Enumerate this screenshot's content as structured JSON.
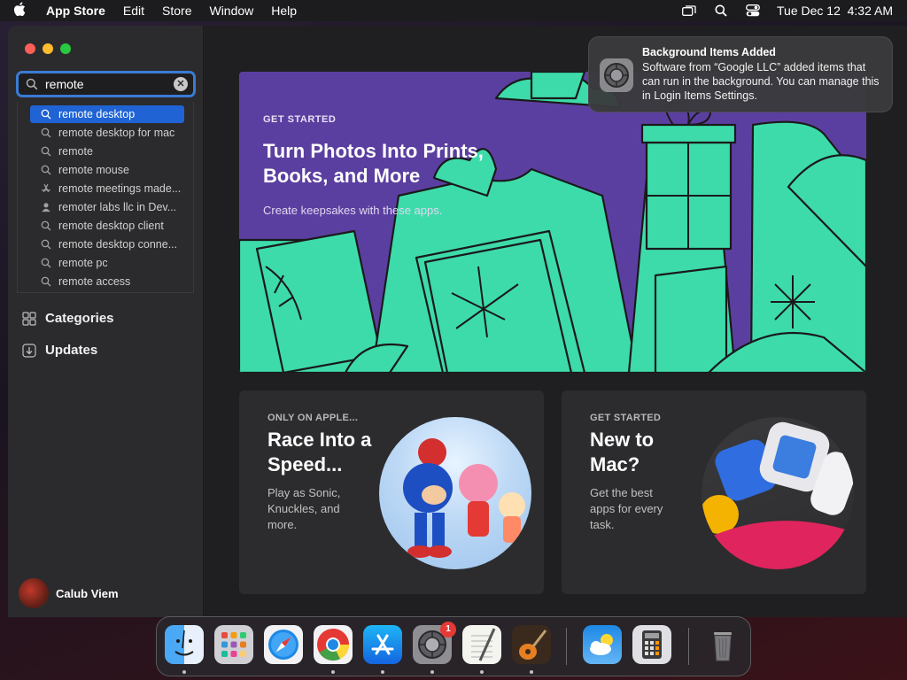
{
  "menubar": {
    "app_name": "App Store",
    "menus": [
      "Edit",
      "Store",
      "Window",
      "Help"
    ],
    "clock": "Tue Dec 12  4:32 AM"
  },
  "search": {
    "value": "remote",
    "suggestions": [
      {
        "text": "remote desktop",
        "icon": "search-icon",
        "selected": true
      },
      {
        "text": "remote desktop for mac",
        "icon": "search-icon"
      },
      {
        "text": "remote",
        "icon": "search-icon"
      },
      {
        "text": "remote mouse",
        "icon": "search-icon"
      },
      {
        "text": "remote meetings made...",
        "icon": "app-icon"
      },
      {
        "text": "remoter labs llc in Dev...",
        "icon": "person-icon"
      },
      {
        "text": "remote desktop client",
        "icon": "search-icon"
      },
      {
        "text": "remote desktop conne...",
        "icon": "search-icon"
      },
      {
        "text": "remote pc",
        "icon": "search-icon"
      },
      {
        "text": "remote access",
        "icon": "search-icon"
      }
    ]
  },
  "sidebar": {
    "categories_label": "Categories",
    "updates_label": "Updates",
    "user_name": "Calub Viem"
  },
  "hero": {
    "kicker": "GET STARTED",
    "title": "Turn Photos Into Prints, Books, and More",
    "subtitle": "Create keepsakes with these apps."
  },
  "cards": [
    {
      "kicker": "ONLY ON APPLE...",
      "title": "Race Into a Speed...",
      "desc": "Play as Sonic, Knuckles, and more."
    },
    {
      "kicker": "GET STARTED",
      "title": "New to Mac?",
      "desc": "Get the best apps for every task."
    }
  ],
  "notification": {
    "title": "Background Items Added",
    "body": "Software from “Google LLC” added items that can run in the background. You can manage this in Login Items Settings."
  },
  "dock": {
    "apps": [
      "Finder",
      "Launchpad",
      "Safari",
      "Chrome",
      "App Store",
      "System Settings",
      "TextEdit",
      "GarageBand",
      "Weather",
      "Calculator",
      "Trash"
    ],
    "settings_badge": "1"
  },
  "colors": {
    "accent": "#1f63d4",
    "hero_bg": "#5b3fa0",
    "hero_art": "#3ddbaa"
  }
}
